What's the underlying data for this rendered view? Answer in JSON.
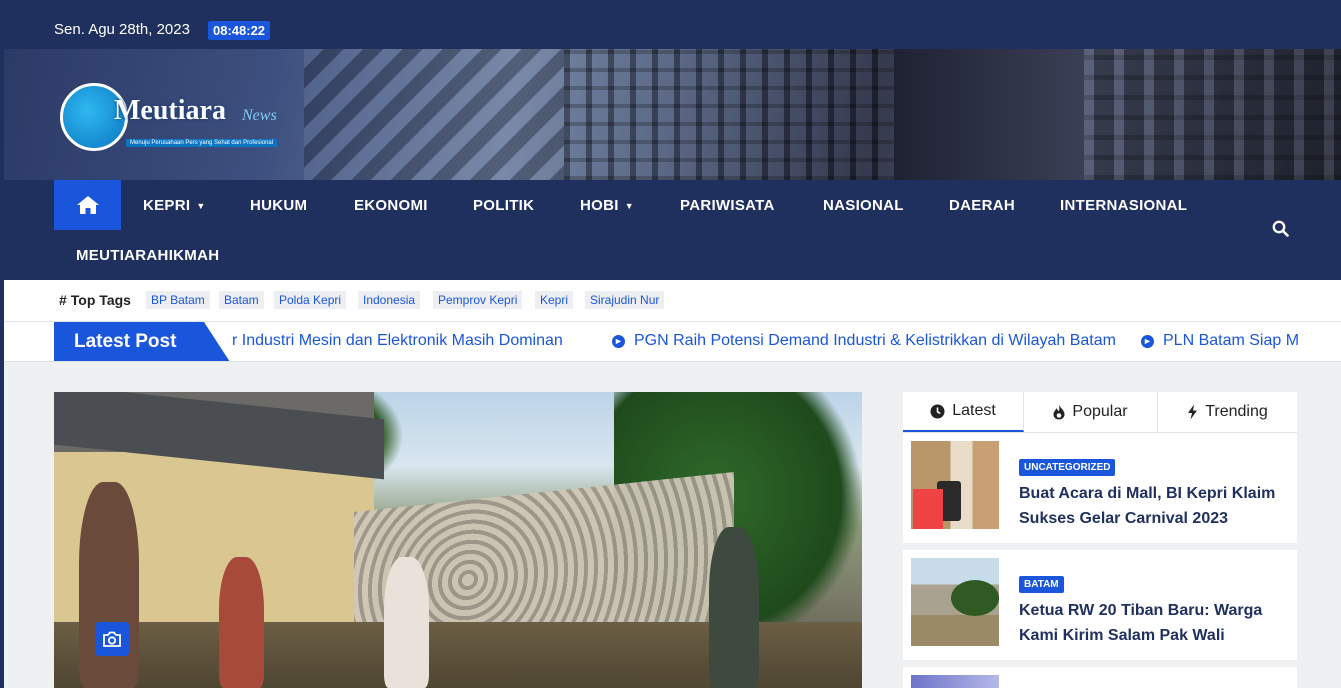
{
  "topbar": {
    "date": "Sen. Agu 28th, 2023",
    "time": "08:48:22"
  },
  "logo": {
    "brand": "Meutiara",
    "script": "News",
    "tagline": "Menuju Perusahaan Pers yang Sehat dan Profesional"
  },
  "nav": {
    "items": [
      "KEPRI",
      "HUKUM",
      "EKONOMI",
      "POLITIK",
      "HOBI",
      "PARIWISATA",
      "NASIONAL",
      "DAERAH",
      "INTERNASIONAL",
      "MEUTIARAHIKMAH"
    ],
    "icons": {
      "home": "home-icon",
      "search": "search-icon"
    }
  },
  "tags": {
    "label": "Top Tags",
    "items": [
      "BP Batam",
      "Batam",
      "Polda Kepri",
      "Indonesia",
      "Pemprov Kepri",
      "Kepri",
      "Sirajudin Nur"
    ]
  },
  "ticker": {
    "label": "Latest Post",
    "items": [
      "r Industri Mesin dan Elektronik Masih Dominan",
      "PGN Raih Potensi Demand Industri & Kelistrikkan di Wilayah Batam",
      "PLN Batam Siap M"
    ]
  },
  "sidebar": {
    "tabs": [
      "Latest",
      "Popular",
      "Trending"
    ],
    "posts": [
      {
        "category": "UNCATEGORIZED",
        "title": "Buat Acara di Mall, BI Kepri Klaim Sukses Gelar Carnival 2023"
      },
      {
        "category": "BATAM",
        "title": "Ketua RW 20 Tiban Baru: Warga Kami Kirim Salam Pak Wali"
      }
    ]
  },
  "colors": {
    "navy": "#1f2f5e",
    "accent": "#1a56db"
  }
}
